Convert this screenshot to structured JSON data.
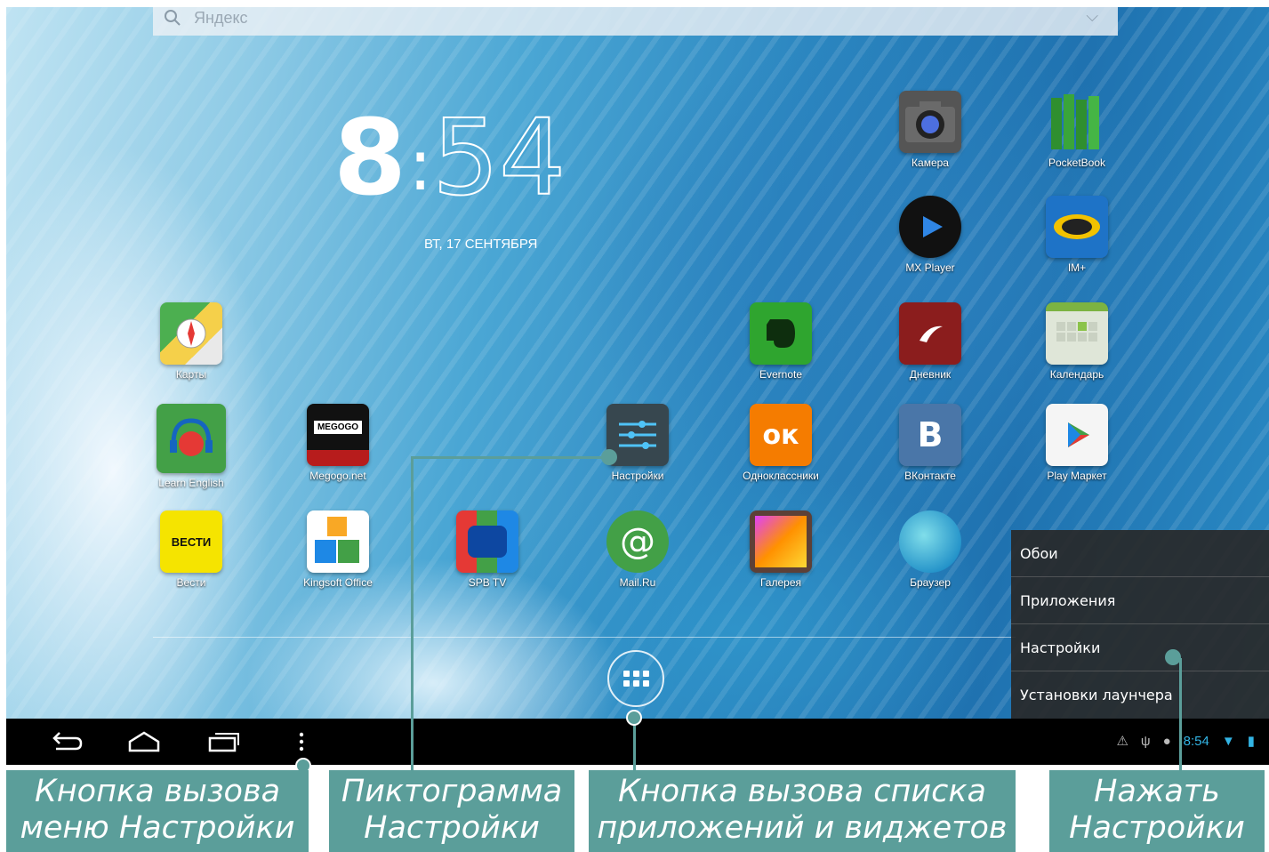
{
  "search": {
    "label": "Яндекс"
  },
  "clock": {
    "hours": "8",
    "separator": ":",
    "minutes": "54",
    "date": "ВТ, 17 СЕНТЯБРЯ"
  },
  "apps": {
    "camera": "Камера",
    "pocketbook": "PocketBook",
    "mxplayer": "MX Player",
    "improg": "IM+",
    "maps": "Карты",
    "evernote": "Evernote",
    "diary": "Дневник",
    "calendar": "Календарь",
    "learnenglish": "Learn English",
    "megogo": "Megogo.net",
    "settings": "Настройки",
    "ok": "Одноклассники",
    "vk": "ВКонтакте",
    "playmarket": "Play Маркет",
    "vesti": "Вести",
    "kingsoft": "Kingsoft Office",
    "spb": "SPB TV",
    "mail": "Mail.Ru",
    "gallery": "Галерея",
    "browser": "Браузер"
  },
  "icon_texts": {
    "vesti": "ВЕСТИ",
    "megogo": "MEGOGO",
    "vk": "В",
    "ok": "ок"
  },
  "menu": [
    "Обои",
    "Приложения",
    "Настройки",
    "Установки лаунчера"
  ],
  "status": {
    "time": "8:54"
  },
  "captions": {
    "menu_button": "Кнопка вызова меню Настройки",
    "settings_icon": "Пиктограмма Настройки",
    "apps_button": "Кнопка вызова списка приложений и виджетов",
    "press_settings": "Нажать Настройки"
  },
  "colors": {
    "callout": "#5b9e9a",
    "status_accent": "#33b5e5"
  }
}
